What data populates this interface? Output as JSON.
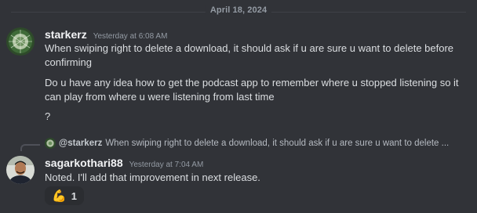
{
  "date_divider": "April 18, 2024",
  "messages": [
    {
      "username": "starkerz",
      "timestamp": "Yesterday at 6:08 AM",
      "lines": [
        "When swiping right to delete a download, it should ask if u are sure u want to delete before confirming",
        "Do u have any idea how to get the podcast app to remember where u stopped listening so it can play from where u were listening from last time",
        "?"
      ]
    },
    {
      "reply_to": {
        "username": "@starkerz",
        "preview": "When swiping right to delete a download, it should ask if u are sure u want to delete ..."
      },
      "username": "sagarkothari88",
      "timestamp": "Yesterday at 7:04 AM",
      "lines": [
        "Noted. I'll add that improvement in next release."
      ],
      "reaction": {
        "emoji": "💪",
        "count": "1"
      }
    }
  ],
  "colors": {
    "background": "#313338",
    "username": "#f2f3f5",
    "muted": "#949ba4",
    "text": "#dbdee1"
  }
}
